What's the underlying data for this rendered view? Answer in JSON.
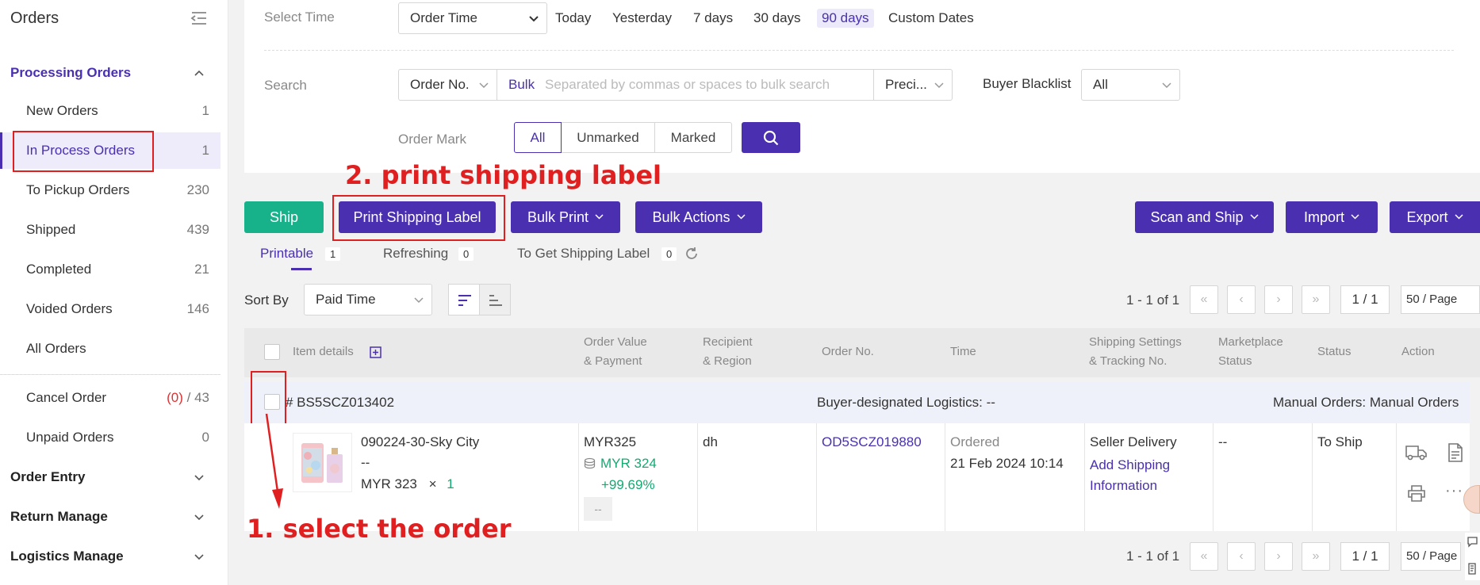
{
  "sidebar": {
    "title": "Orders",
    "groups": {
      "processing": "Processing Orders",
      "order_entry": "Order Entry",
      "return_manage": "Return Manage",
      "logistics_manage": "Logistics Manage"
    },
    "items": [
      {
        "label": "New Orders",
        "count": "1"
      },
      {
        "label": "In Process Orders",
        "count": "1"
      },
      {
        "label": "To Pickup Orders",
        "count": "230"
      },
      {
        "label": "Shipped",
        "count": "439"
      },
      {
        "label": "Completed",
        "count": "21"
      },
      {
        "label": "Voided Orders",
        "count": "146"
      },
      {
        "label": "All Orders",
        "count": ""
      }
    ],
    "cancel": {
      "label": "Cancel Order",
      "count_red": "(0)",
      "count_rest": " / 43"
    },
    "unpaid": {
      "label": "Unpaid Orders",
      "count": "0"
    }
  },
  "filter": {
    "select_time_label": "Select Time",
    "time_field": "Order Time",
    "time_options": [
      "Today",
      "Yesterday",
      "7 days",
      "30 days",
      "90 days",
      "Custom Dates"
    ],
    "selected_time": "90 days",
    "search_label": "Search",
    "search_field": "Order No.",
    "bulk_label": "Bulk",
    "search_placeholder": "Separated by commas or spaces to bulk search",
    "precision": "Preci...",
    "blacklist_label": "Buyer Blacklist",
    "blacklist_value": "All",
    "order_mark_label": "Order Mark",
    "mark_options": [
      "All",
      "Unmarked",
      "Marked"
    ]
  },
  "actions": {
    "ship": "Ship",
    "print_label": "Print Shipping Label",
    "bulk_print": "Bulk Print",
    "bulk_actions": "Bulk Actions",
    "scan_ship": "Scan and Ship",
    "import": "Import",
    "export": "Export"
  },
  "subtabs": [
    {
      "label": "Printable",
      "count": "1"
    },
    {
      "label": "Refreshing",
      "count": "0"
    },
    {
      "label": "To Get Shipping Label",
      "count": "0"
    }
  ],
  "sort": {
    "label": "Sort By",
    "value": "Paid Time"
  },
  "pagination": {
    "info": "1 - 1 of 1",
    "page": "1 / 1",
    "size": "50 / Page"
  },
  "table": {
    "headers": {
      "item": "Item details",
      "value1": "Order Value",
      "value2": "& Payment",
      "recipient1": "Recipient",
      "recipient2": "& Region",
      "order_no": "Order No.",
      "time": "Time",
      "shipping1": "Shipping Settings",
      "shipping2": "& Tracking No.",
      "market1": "Marketplace",
      "market2": "Status",
      "status": "Status",
      "action": "Action"
    },
    "order": {
      "id": "# BS5SCZ013402",
      "logistics": "Buyer-designated Logistics: --",
      "source": "Manual Orders: Manual Orders",
      "product_name": "090224-30-Sky City",
      "variant": "--",
      "price": "MYR 323",
      "times": "×",
      "qty": "1",
      "order_value": "MYR325",
      "payout": "MYR 324",
      "margin": "+99.69%",
      "memo": "--",
      "recipient": "dh",
      "order_no": "OD5SCZ019880",
      "time_label": "Ordered",
      "time_value": "21 Feb 2024 10:14",
      "shipping_method": "Seller Delivery",
      "add_shipping": "Add Shipping",
      "add_shipping2": "Information",
      "marketplace_status": "--",
      "status": "To Ship"
    }
  },
  "annotations": {
    "step1": "1. select the order",
    "step2": "2. print shipping label"
  },
  "colors": {
    "brand": "#4a30b0",
    "ship": "#17b18a",
    "annotation": "#e02020"
  }
}
